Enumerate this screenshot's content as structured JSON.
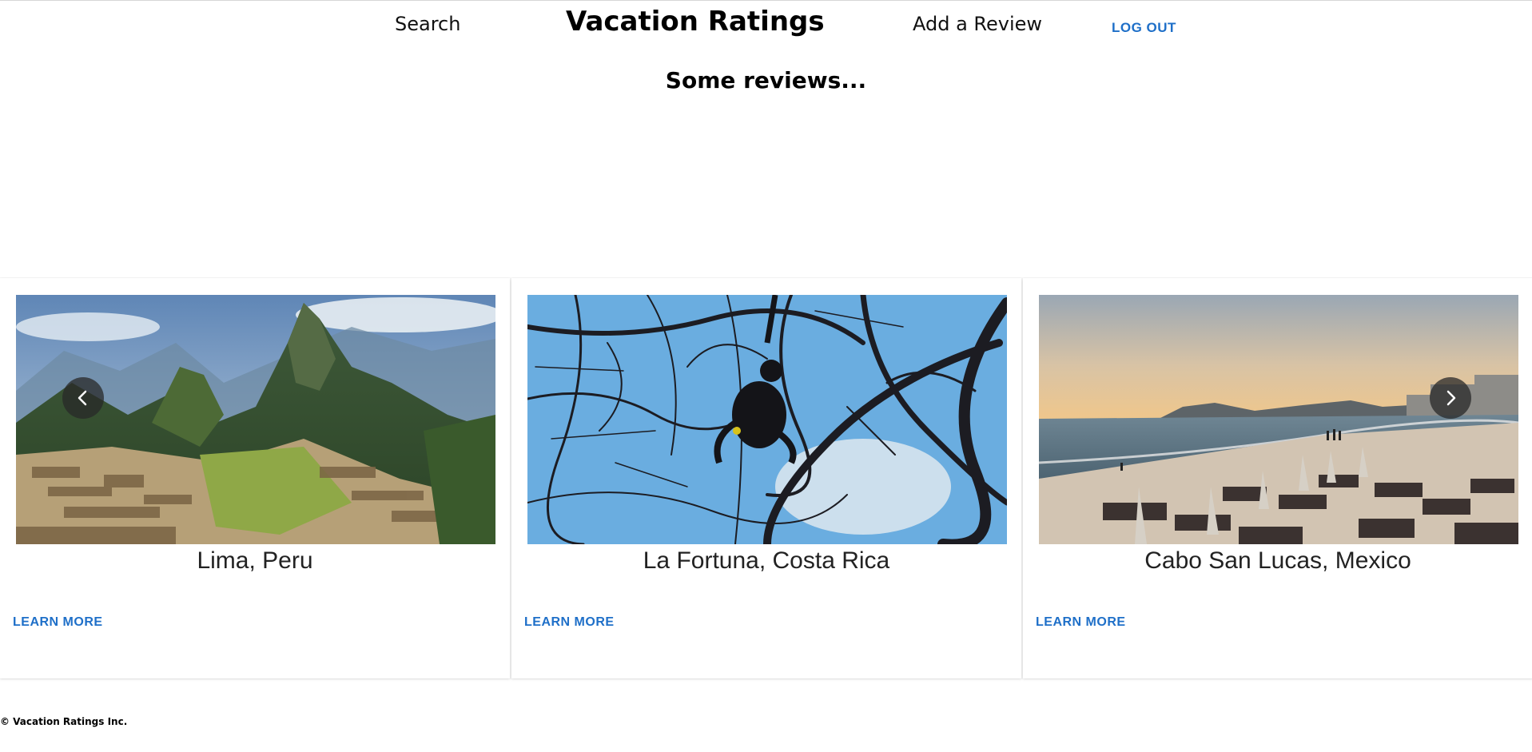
{
  "nav": {
    "search_label": "Search",
    "title": "Vacation Ratings",
    "add_review_label": "Add a Review",
    "logout_label": "LOG OUT"
  },
  "main": {
    "heading": "Some reviews..."
  },
  "carousel": {
    "prev_icon": "chevron-left-icon",
    "next_icon": "chevron-right-icon",
    "cards": [
      {
        "title": "Lima, Peru",
        "learn_more": "LEARN MORE",
        "image": "machu-picchu-mountain-ruins"
      },
      {
        "title": "La Fortuna, Costa Rica",
        "learn_more": "LEARN MORE",
        "image": "monkey-in-tree-branches"
      },
      {
        "title": "Cabo San Lucas, Mexico",
        "learn_more": "LEARN MORE",
        "image": "beach-at-sunset"
      }
    ]
  },
  "footer": {
    "text": "© Vacation Ratings Inc."
  },
  "colors": {
    "link": "#1e6fc8",
    "arrow_bg": "#282828"
  }
}
